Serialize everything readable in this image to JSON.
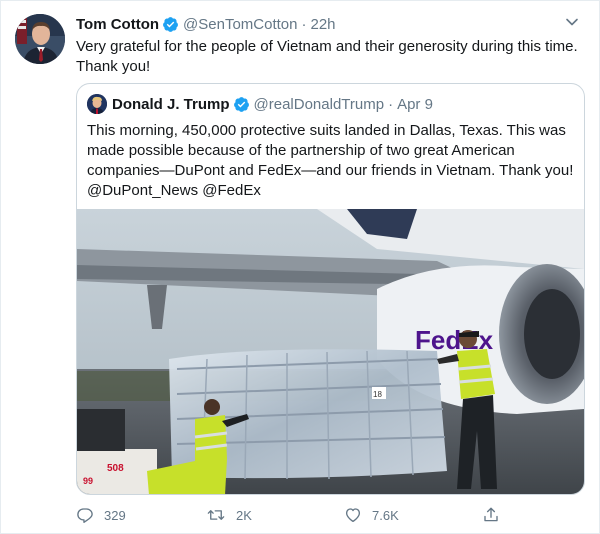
{
  "tweet": {
    "author_name": "Tom Cotton",
    "author_handle": "@SenTomCotton",
    "separator": "·",
    "time": "22h",
    "text": "Very grateful for the people of Vietnam and their generosity during this time. Thank you!",
    "avatar_icon": "person-avatar",
    "verified_icon": "verified-badge-icon",
    "caret_icon": "chevron-down-icon"
  },
  "quote": {
    "author_name": "Donald J. Trump",
    "author_handle": "@realDonaldTrump",
    "separator": "·",
    "time": "Apr 9",
    "text": "This morning, 450,000 protective suits landed in Dallas, Texas. This was made possible because of the partnership of two great American companies—DuPont and FedEx—and our friends in Vietnam. Thank you! @DuPont_News @FedEx",
    "media": {
      "description_icon": "photo",
      "brand_text": "FedEx",
      "vehicle_number": "508",
      "vehicle_number_2": "99",
      "crate_label": "18"
    }
  },
  "actions": {
    "reply_count": "329",
    "retweet_count": "2K",
    "like_count": "7.6K",
    "reply_icon": "reply-icon",
    "retweet_icon": "retweet-icon",
    "like_icon": "heart-icon",
    "share_icon": "share-icon"
  },
  "colors": {
    "text": "#14171a",
    "muted": "#657786",
    "verified": "#1da1f2",
    "border": "#ccd6dd",
    "fedex_purple": "#4d148c",
    "fedex_orange": "#ff6600",
    "safety_vest": "#c7e02a"
  }
}
